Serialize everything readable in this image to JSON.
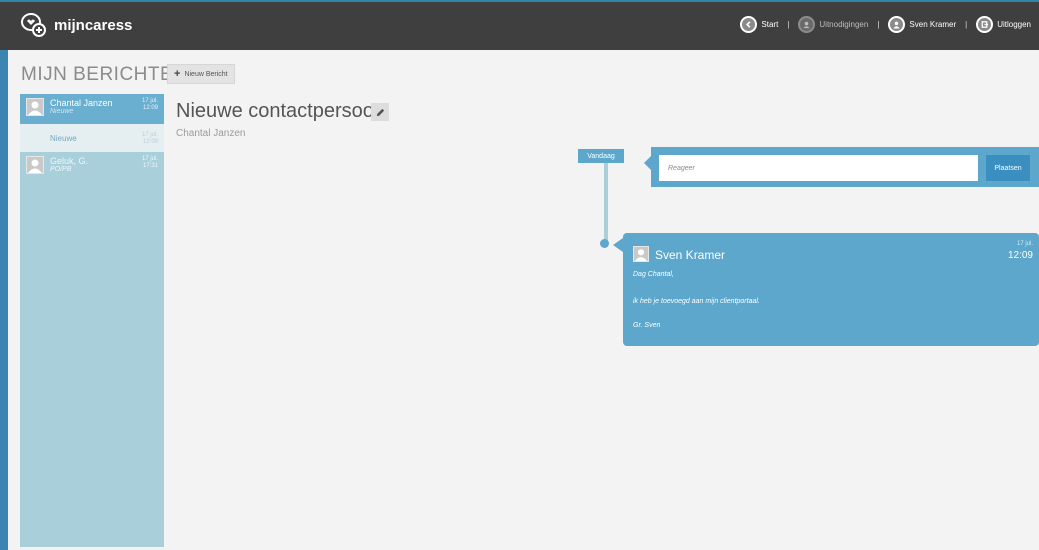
{
  "app": {
    "name": "mijncaress"
  },
  "nav": {
    "start": "Start",
    "invitations": "Uitnodigingen",
    "user": "Sven Kramer",
    "logout": "Uitloggen",
    "separator": "|"
  },
  "page": {
    "title": "MIJN BERICHTEN",
    "new_message": "Nieuw Bericht"
  },
  "conversations": [
    {
      "name": "Chantal Janzen",
      "subtitle": "Nieuwe",
      "date": "17 jul.",
      "time": "12:09"
    },
    {
      "name": "Nieuwe",
      "date": "17 jul.",
      "time": "12:09"
    },
    {
      "name": "Geluk, G.",
      "subtitle": "PO/PB",
      "date": "17 jul.",
      "time": "17:31"
    }
  ],
  "conversation": {
    "title": "Nieuwe contactpersoon",
    "participant": "Chantal Janzen"
  },
  "timeline": {
    "date_label": "Vandaag"
  },
  "reply": {
    "placeholder": "Reageer",
    "button": "Plaatsen"
  },
  "message": {
    "author": "Sven Kramer",
    "date": "17 jul.",
    "time": "12:09",
    "lines": [
      "Dag Chantal,",
      "ik heb je toevoegd aan mijn clientportaal.",
      "Gr. Sven"
    ]
  },
  "colors": {
    "topbar": "#3f3f3f",
    "accent": "#5ca7cb",
    "sidebar": "#a9cfdb",
    "selected": "#6aaed0",
    "background": "#f3f3f3"
  },
  "icons": [
    "chat-bubbles-logo-icon",
    "back-arrow-icon",
    "invitations-icon",
    "user-avatar-icon",
    "logout-icon",
    "plus-icon",
    "pencil-icon"
  ]
}
